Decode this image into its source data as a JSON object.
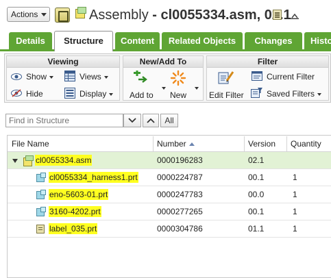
{
  "header": {
    "actions_label": "Actions",
    "title_name": "Assembly",
    "title_sep": " - ",
    "title_object": "cl0055334.asm, 02.1"
  },
  "tabs": [
    {
      "label": "Details"
    },
    {
      "label": "Structure",
      "active": true
    },
    {
      "label": "Content"
    },
    {
      "label": "Related Objects"
    },
    {
      "label": "Changes"
    },
    {
      "label": "Histo"
    }
  ],
  "toolbar": {
    "viewing": {
      "title": "Viewing",
      "show": "Show",
      "hide": "Hide",
      "views": "Views",
      "display": "Display"
    },
    "new_add": {
      "title": "New/Add To",
      "add_to": "Add to",
      "new": "New"
    },
    "filter": {
      "title": "Filter",
      "edit_filter": "Edit Filter",
      "current_filter": "Current Filter",
      "saved_filters": "Saved Filters"
    }
  },
  "find": {
    "placeholder": "Find in Structure",
    "all_label": "All"
  },
  "table": {
    "columns": [
      "File Name",
      "Number",
      "Version",
      "Quantity"
    ],
    "rows": [
      {
        "name": "cl0055334.asm",
        "number": "0000196283",
        "version": "02.1",
        "quantity": "",
        "icon": "assembly-icon"
      },
      {
        "name": "cl0055334_harness1.prt",
        "number": "0000224787",
        "version": "00.1",
        "quantity": "1",
        "icon": "part-icon"
      },
      {
        "name": "eno-5603-01.prt",
        "number": "0000247783",
        "version": "00.0",
        "quantity": "1",
        "icon": "part-icon"
      },
      {
        "name": "3160-4202.prt",
        "number": "0000277265",
        "version": "00.1",
        "quantity": "1",
        "icon": "part-icon"
      },
      {
        "name": "label_035.prt",
        "number": "0000304786",
        "version": "01.1",
        "quantity": "1",
        "icon": "label-part-icon"
      }
    ]
  },
  "colors": {
    "tab_green": "#5fa534",
    "selected_row": "#e2f2d5",
    "highlight": "#ffff20"
  }
}
